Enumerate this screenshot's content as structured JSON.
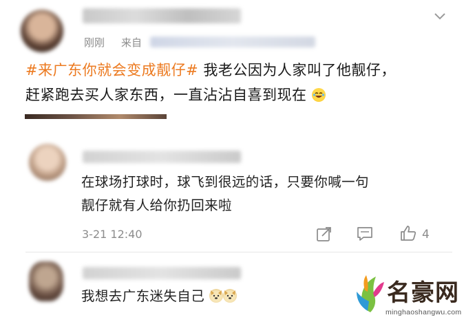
{
  "post": {
    "user_name": "███████",
    "time": "刚刚",
    "source_label": "来自",
    "source_name": "███████",
    "topic": "#来广东你就会变成靓仔#",
    "text_line1": " 我老公因为人家叫了他靓仔，",
    "text_line2": "赶紧跑去买人家东西，一直沾沾自喜到现在",
    "emoji": "laughing-tears-emoji"
  },
  "comments": [
    {
      "user_name": "██████████",
      "line1": "在球场打球时，球飞到很远的话，只要你喊一句",
      "line2": "靓仔就有人给你扔回来啦",
      "time": "3-21 12:40",
      "like_count": "4"
    },
    {
      "user_name": "████████████",
      "line1": "我想去广东迷失自己",
      "emojis": [
        "doge-emoji",
        "doge-emoji"
      ]
    }
  ],
  "watermark": {
    "title": "名豪网",
    "url": "minghaoshangwu.com"
  },
  "colors": {
    "topic": "#ec7a20",
    "meta": "#8c8c8c",
    "divider": "#e6e6e6"
  }
}
